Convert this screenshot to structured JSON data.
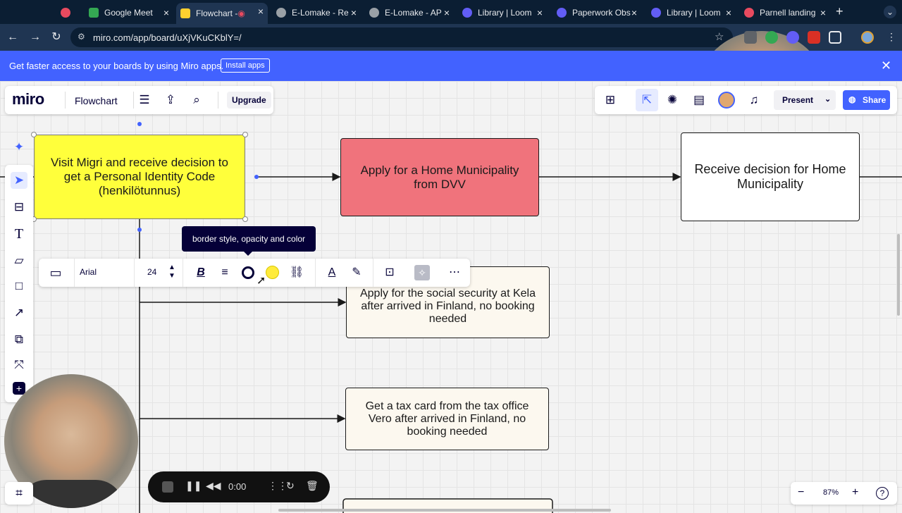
{
  "browser": {
    "tabs": [
      {
        "label": "",
        "favicon_color": "#e84a5f"
      },
      {
        "label": "Google Meet",
        "favicon_color": "#34a853"
      },
      {
        "label": "Flowchart - ",
        "favicon_color": "#ffd02f",
        "active": true
      },
      {
        "label": "E-Lomake - Re",
        "favicon_color": "#9aa0a6"
      },
      {
        "label": "E-Lomake - AP",
        "favicon_color": "#9aa0a6"
      },
      {
        "label": "Library | Loom",
        "favicon_color": "#625df5"
      },
      {
        "label": "Paperwork Obs",
        "favicon_color": "#625df5"
      },
      {
        "label": "Library | Loom",
        "favicon_color": "#625df5"
      },
      {
        "label": "Parnell landing",
        "favicon_color": "#e84a5f"
      }
    ],
    "url": "miro.com/app/board/uXjVKuCKblY=/"
  },
  "banner": {
    "message": "Get faster access to your boards by using Miro apps.",
    "install_label": "Install apps"
  },
  "header": {
    "logo": "miro",
    "board_name": "Flowchart",
    "upgrade_label": "Upgrade",
    "present_label": "Present",
    "share_label": "Share"
  },
  "nodes": {
    "visit_migri": "Visit Migri and receive decision to get a Personal Identity Code (henkilötunnus)",
    "home_municipality": "Apply for a Home Municipality from DVV",
    "receive_decision": "Receive decision for Home Municipality",
    "kela": "Apply for the social security at Kela after arrived in Finland, no booking needed",
    "tax_card": "Get a tax card from the tax office Vero after arrived in Finland, no booking needed"
  },
  "node_colors": {
    "visit_migri": "#ffff3b",
    "home_municipality": "#f0737c",
    "receive_decision": "#ffffff",
    "kela": "#fcf8ef",
    "tax_card": "#fcf8ef"
  },
  "toolbar": {
    "font_name": "Arial",
    "font_size": "24",
    "tooltip": "border style, opacity and color",
    "fill_color": "#ffeb3b"
  },
  "recorder": {
    "timer": "0:00"
  },
  "zoom": {
    "level": "87%"
  }
}
